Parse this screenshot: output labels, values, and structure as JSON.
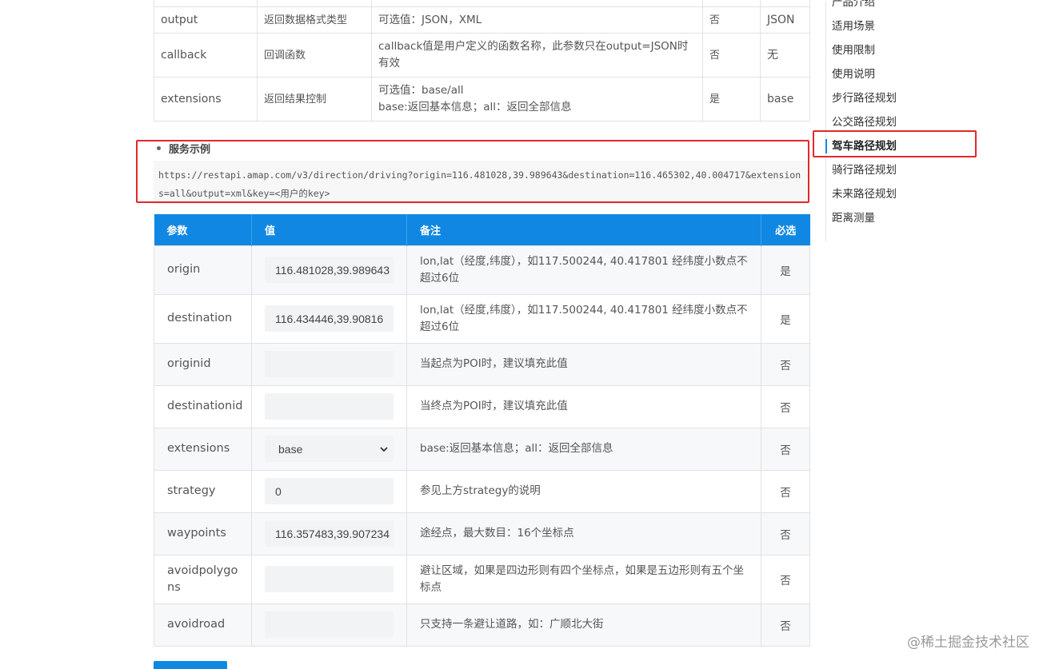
{
  "top_params": [
    {
      "name": "output",
      "desc": "返回数据格式类型",
      "note": "可选值：JSON，XML",
      "required": "否",
      "default": "JSON"
    },
    {
      "name": "callback",
      "desc": "回调函数",
      "note": "callback值是用户定义的函数名称，此参数只在output=JSON时有效",
      "required": "否",
      "default": "无"
    },
    {
      "name": "extensions",
      "desc": "返回结果控制",
      "note_line1": "可选值：base/all",
      "note_line2": "base:返回基本信息；all：返回全部信息",
      "required": "是",
      "default": "base"
    }
  ],
  "example": {
    "title": "服务示例",
    "url": "https://restapi.amap.com/v3/direction/driving?origin=116.481028,39.989643&destination=116.465302,40.004717&extensions=all&output=xml&key=<用户的key>"
  },
  "form": {
    "headers": {
      "param": "参数",
      "value": "值",
      "note": "备注",
      "required": "必选"
    },
    "rows": [
      {
        "name": "origin",
        "value": "116.481028,39.989643",
        "note": "lon,lat（经度,纬度），如117.500244, 40.417801 经纬度小数点不超过6位",
        "required": "是"
      },
      {
        "name": "destination",
        "value": "116.434446,39.90816",
        "note": "lon,lat（经度,纬度），如117.500244, 40.417801 经纬度小数点不超过6位",
        "required": "是"
      },
      {
        "name": "originid",
        "value": "",
        "note": "当起点为POI时，建议填充此值",
        "required": "否"
      },
      {
        "name": "destinationid",
        "value": "",
        "note": "当终点为POI时，建议填充此值",
        "required": "否"
      },
      {
        "name": "extensions",
        "value": "base",
        "note": "base:返回基本信息；all：返回全部信息",
        "required": "否"
      },
      {
        "name": "strategy",
        "value": "0",
        "note": "参见上方strategy的说明",
        "required": "否"
      },
      {
        "name": "waypoints",
        "value": "116.357483,39.907234",
        "note": "途经点，最大数目：16个坐标点",
        "required": "否"
      },
      {
        "name": "avoidpolygons",
        "value": "",
        "note": "避让区域，如果是四边形则有四个坐标点，如果是五边形则有五个坐标点",
        "required": "否"
      },
      {
        "name": "avoidroad",
        "value": "",
        "note": "只支持一条避让道路，如：广顺北大街",
        "required": "否"
      }
    ]
  },
  "sidebar": {
    "items": [
      "产品介绍",
      "适用场景",
      "使用限制",
      "使用说明",
      "步行路径规划",
      "公交路径规划",
      "驾车路径规划",
      "骑行路径规划",
      "未来路径规划",
      "距离测量"
    ],
    "active": "驾车路径规划"
  },
  "watermark": "@稀土掘金技术社区",
  "colors": {
    "accent": "#1088e3",
    "highlight": "#e02a2a"
  }
}
